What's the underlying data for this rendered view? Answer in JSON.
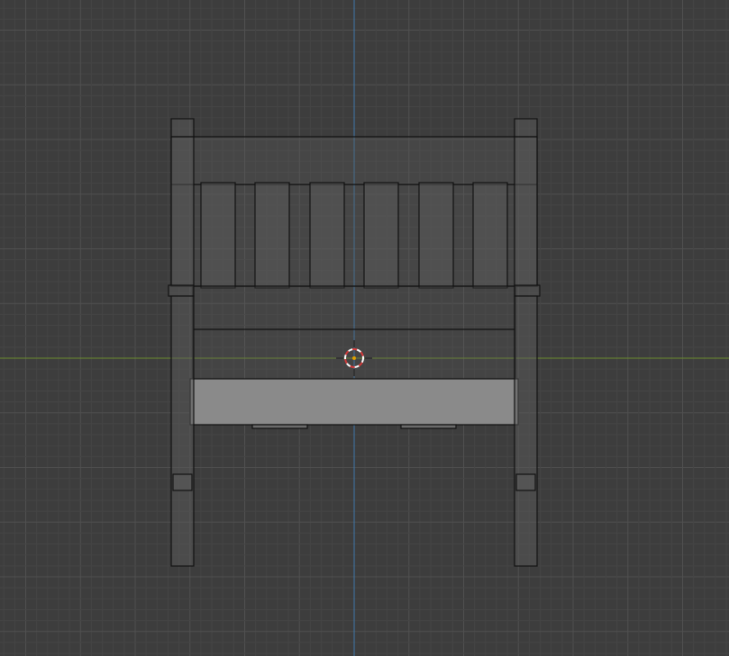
{
  "viewport": {
    "view": "front",
    "background_color": "#3d3d3d",
    "grid_minor_color": "#454545",
    "grid_major_color": "#505050",
    "axis_x_color": "#6c8c2f",
    "axis_z_color": "#3e78ab"
  },
  "model": {
    "object": "chair",
    "mode": "wireframe",
    "wire_color": "#111111",
    "face_color": "#5a5a5a",
    "seat_front_color": "#8a8a8a",
    "back_slat_count": 6
  },
  "cursor_3d": {
    "icon": "3d-cursor-icon",
    "ring_color_a": "#d43a3a",
    "ring_color_b": "#ffffff"
  }
}
